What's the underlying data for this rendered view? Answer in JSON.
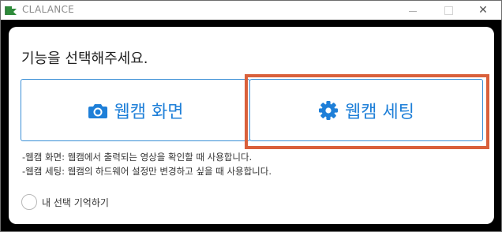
{
  "window": {
    "title": "CLALANCE",
    "minimize_glyph": "",
    "close_glyph": "✕"
  },
  "dialog": {
    "prompt": "기능을 선택해주세요.",
    "options": [
      {
        "label": "웹캠 화면",
        "icon": "camera-icon"
      },
      {
        "label": "웹캠 세팅",
        "icon": "gear-icon"
      }
    ],
    "descriptions": [
      "-웹캠 화면: 웹캠에서 출력되는 영상을 확인할 때 사용합니다.",
      "-웹캠 세팅: 웹캠의 하드웨어 설정만 변경하고 싶을 때 사용합니다."
    ],
    "remember_label": "내 선택 기억하기",
    "remember_checked": false
  },
  "colors": {
    "accent": "#1e7fd8",
    "border": "#3a8fd6",
    "highlight": "#d9603b",
    "app_icon": "#2e8b3a"
  }
}
